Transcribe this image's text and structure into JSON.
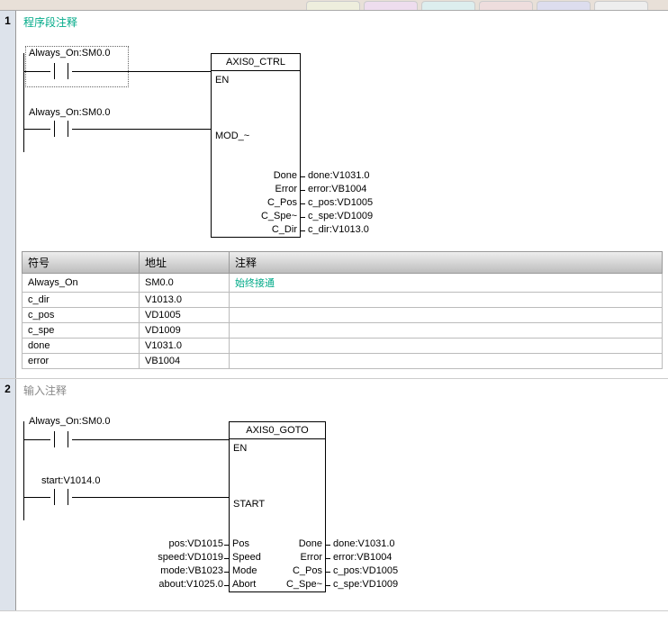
{
  "tabs": {
    "count": 6
  },
  "network1": {
    "num": "1",
    "title": "程序段注释",
    "contact1_label": "Always_On:SM0.0",
    "contact2_label": "Always_On:SM0.0",
    "block": {
      "title": "AXIS0_CTRL",
      "pin_en": "EN",
      "pin_mod": "MOD_~",
      "outputs": [
        {
          "pin": "Done",
          "ext": "done:V1031.0"
        },
        {
          "pin": "Error",
          "ext": "error:VB1004"
        },
        {
          "pin": "C_Pos",
          "ext": "c_pos:VD1005"
        },
        {
          "pin": "C_Spe~",
          "ext": "c_spe:VD1009"
        },
        {
          "pin": "C_Dir",
          "ext": "c_dir:V1013.0"
        }
      ]
    }
  },
  "symtable": {
    "headers": {
      "sym": "符号",
      "addr": "地址",
      "comment": "注释"
    },
    "rows": [
      {
        "sym": "Always_On",
        "addr": "SM0.0",
        "comment": "始终接通",
        "green": true
      },
      {
        "sym": "c_dir",
        "addr": "V1013.0",
        "comment": ""
      },
      {
        "sym": "c_pos",
        "addr": "VD1005",
        "comment": ""
      },
      {
        "sym": "c_spe",
        "addr": "VD1009",
        "comment": ""
      },
      {
        "sym": "done",
        "addr": "V1031.0",
        "comment": ""
      },
      {
        "sym": "error",
        "addr": "VB1004",
        "comment": ""
      }
    ]
  },
  "network2": {
    "num": "2",
    "title": "输入注释",
    "contact1_label": "Always_On:SM0.0",
    "contact2_label": "start:V1014.0",
    "block": {
      "title": "AXIS0_GOTO",
      "pin_en": "EN",
      "pin_start": "START",
      "left_inputs": [
        {
          "ext": "pos:VD1015",
          "pin": "Pos"
        },
        {
          "ext": "speed:VD1019",
          "pin": "Speed"
        },
        {
          "ext": "mode:VB1023",
          "pin": "Mode"
        },
        {
          "ext": "about:V1025.0",
          "pin": "Abort"
        }
      ],
      "right_outputs": [
        {
          "pin": "Done",
          "ext": "done:V1031.0"
        },
        {
          "pin": "Error",
          "ext": "error:VB1004"
        },
        {
          "pin": "C_Pos",
          "ext": "c_pos:VD1005"
        },
        {
          "pin": "C_Spe~",
          "ext": "c_spe:VD1009"
        }
      ]
    }
  }
}
